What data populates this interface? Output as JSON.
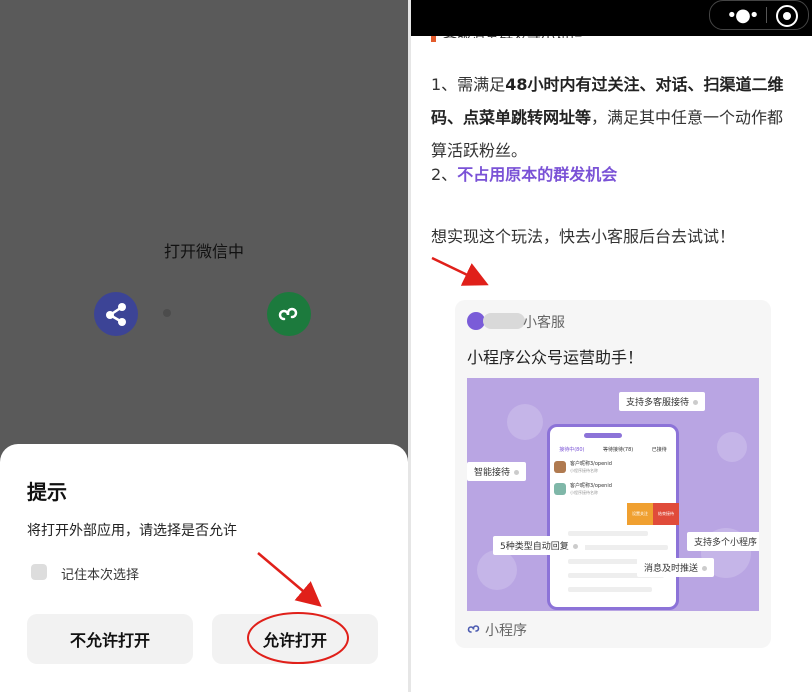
{
  "left_panel": {
    "open_title": "打开微信中",
    "dialog": {
      "title": "提示",
      "message": "将打开外部应用，请选择是否允许",
      "remember_label": "记住本次选择",
      "deny_label": "不允许打开",
      "allow_label": "允许打开"
    }
  },
  "right_panel": {
    "section_heading": "客服消息群发等小知识",
    "para1_prefix": "1、需满足",
    "para1_bold": "48小时内有过关注、对话、扫渠道二维码、点菜单跳转网址等",
    "para1_suffix": "，满足其中任意一个动作都算活跃粉丝。",
    "para2_prefix": "2、",
    "para2_highlight": "不占用原本的群发机会",
    "para3": "想实现这个玩法，快去小客服后台去试试！",
    "card": {
      "name": "小客服",
      "title": "小程序公众号运营助手！",
      "footer_label": "小程序",
      "image_tags": [
        "支持多客服接待",
        "智能接待",
        "5种类型自动回复",
        "支持多个小程序",
        "消息及时推送"
      ],
      "phone": {
        "tabs": [
          "接待中(80)",
          "等待接待(78)",
          "已接待"
        ],
        "row1_name": "客户昵称3/openid",
        "row2_name": "客户昵称3/openid",
        "row_sub": "小程序接待名称",
        "btn1": "设置关注",
        "btn2": "结束接待"
      }
    }
  },
  "colors": {
    "accent_purple": "#7a52d6",
    "annotation_red": "#e0201a",
    "section_mark": "#e35b2c"
  }
}
